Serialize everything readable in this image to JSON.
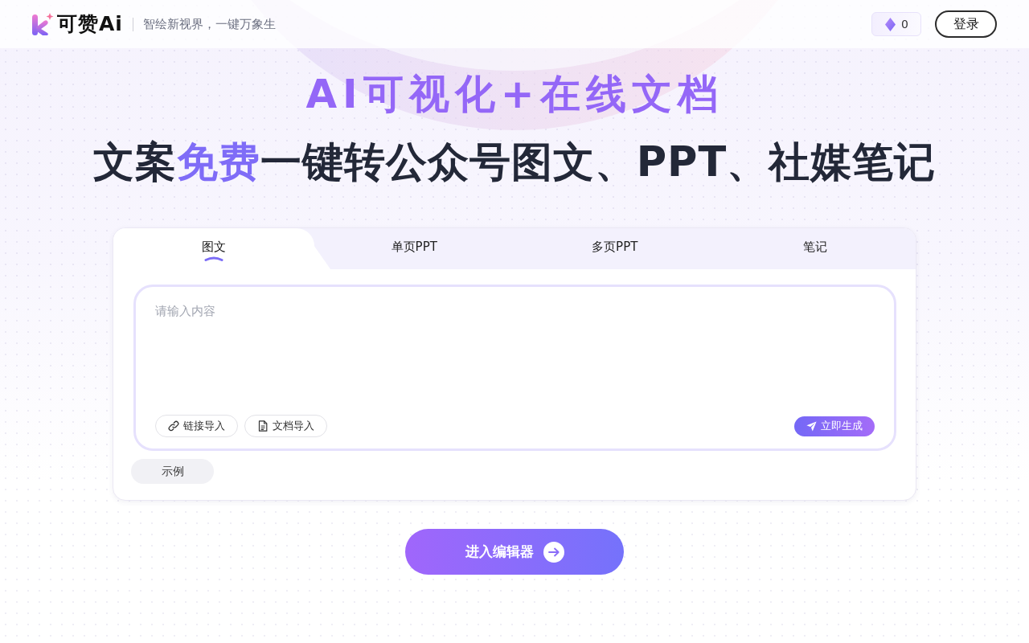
{
  "header": {
    "brand": "可赞Ai",
    "slogan": "智绘新视界，一键万象生",
    "credits": "0",
    "login_button": "登录"
  },
  "hero": {
    "title": "AI可视化+在线文档",
    "subtitle": "文案**免费**一键转公众号图文、PPT、社媒笔记"
  },
  "composer": {
    "tabs": [
      {
        "label": "图文",
        "selected": true
      },
      {
        "label": "单页PPT",
        "selected": false
      },
      {
        "label": "多页PPT",
        "selected": false
      },
      {
        "label": "笔记",
        "selected": false
      }
    ],
    "input": {
      "placeholder": "请输入内容"
    },
    "import_buttons": [
      {
        "kind": "link",
        "label": "链接导入"
      },
      {
        "kind": "document",
        "label": "文档导入"
      }
    ],
    "generate_button": "立即生成",
    "example_button": "示例"
  },
  "enter_editor_button": "进入编辑器"
}
